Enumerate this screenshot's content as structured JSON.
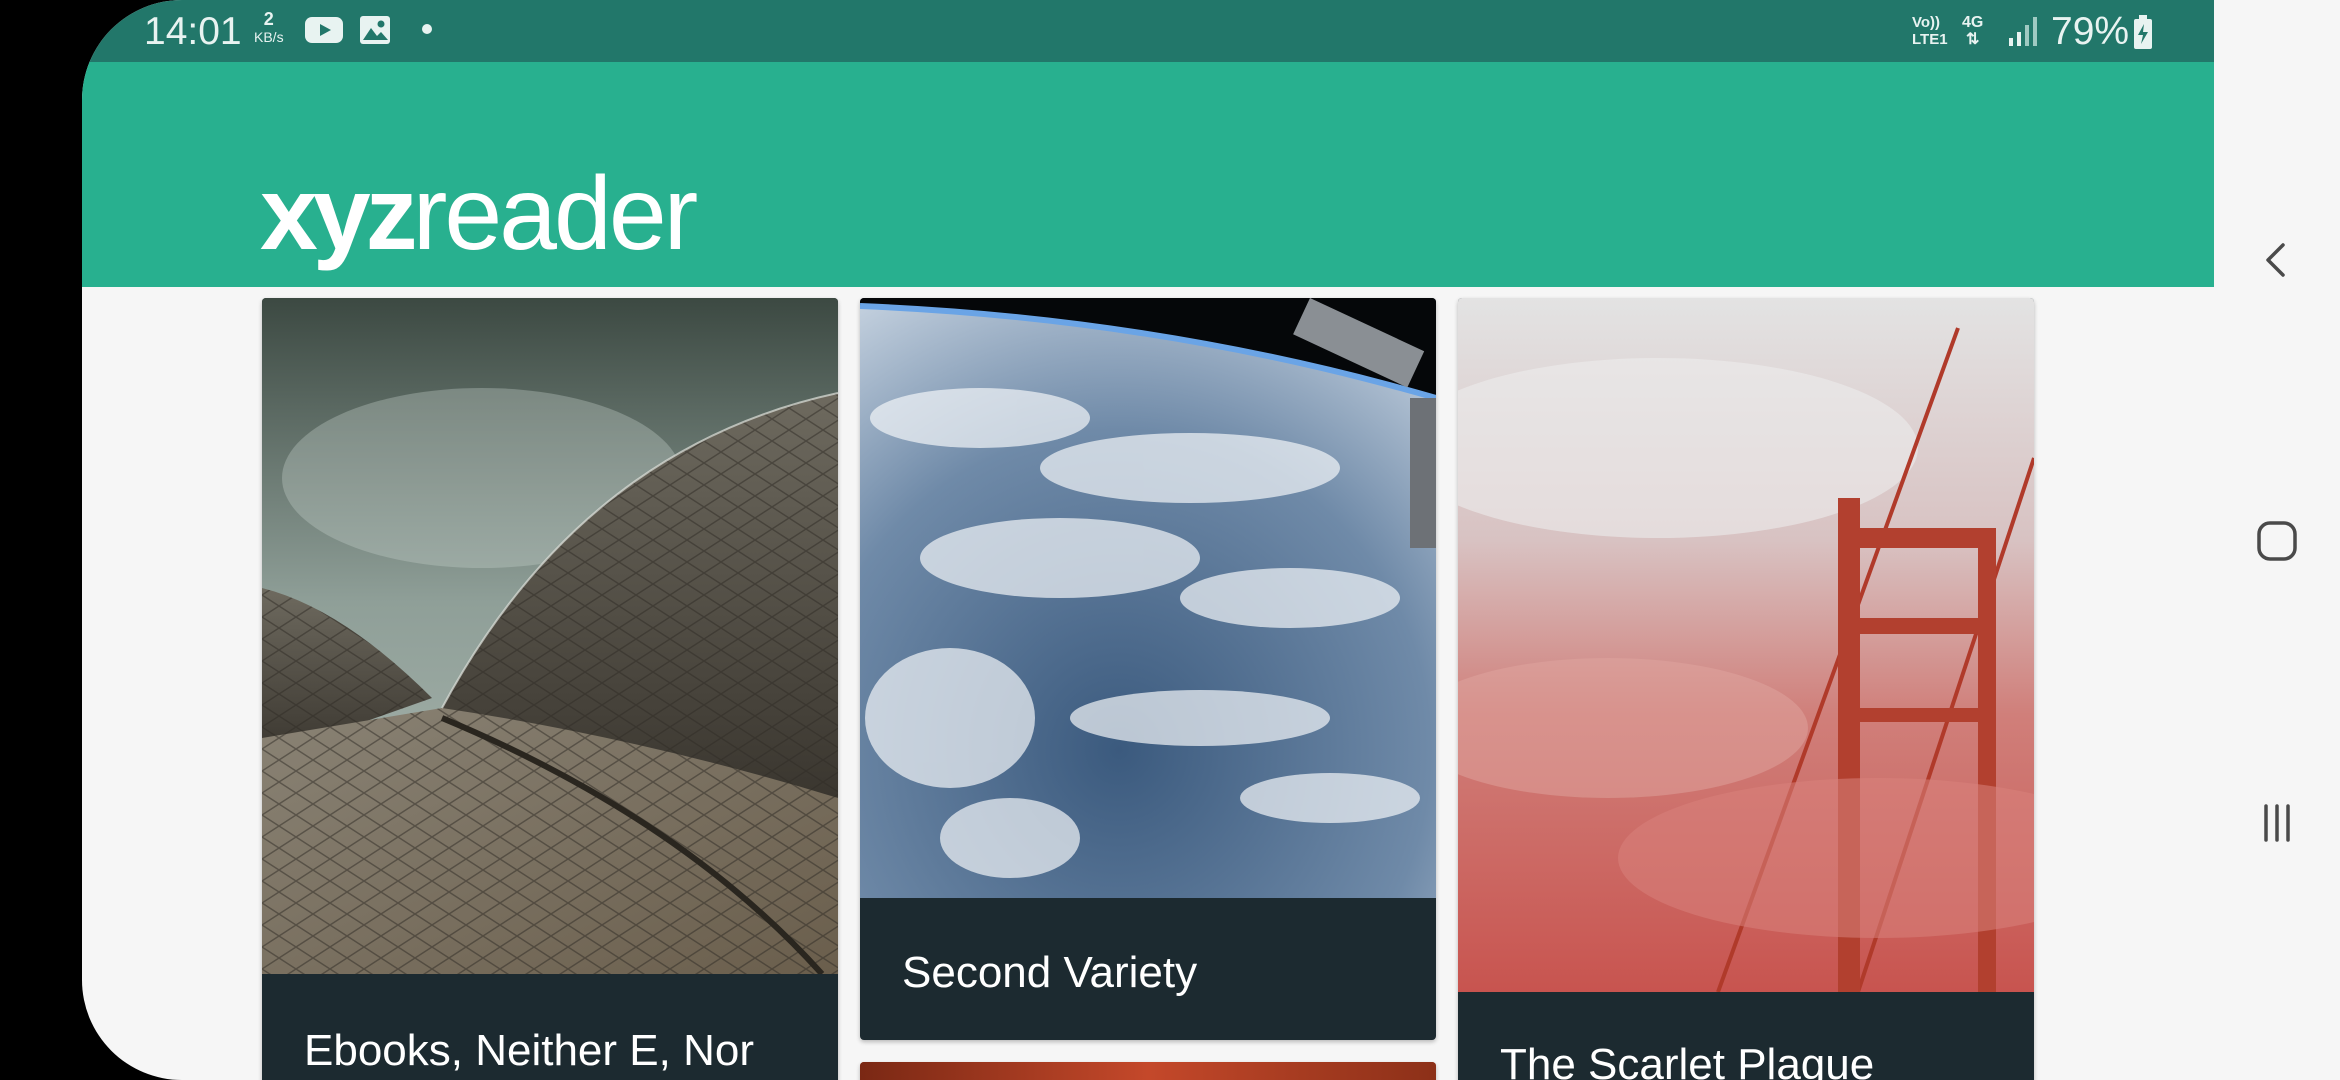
{
  "status_bar": {
    "time": "14:01",
    "net_speed_value": "2",
    "net_speed_unit": "KB/s",
    "volte_line1": "Vo))",
    "volte_line2": "LTE1",
    "network_type": "4G",
    "battery_percent": "79%",
    "notification_icons": [
      "youtube-icon",
      "gallery-icon"
    ]
  },
  "app_bar": {
    "logo_bold": "xyz",
    "logo_light": "reader",
    "color": "#28b08f"
  },
  "articles": [
    {
      "title": "Ebooks, Neither E, Nor",
      "image": "sydney-opera-house-shells"
    },
    {
      "title": "Second Variety",
      "image": "earth-from-orbit"
    },
    {
      "title": "The Scarlet Plague",
      "image": "golden-gate-bridge-in-red-fog"
    }
  ],
  "navigation_bar": {
    "buttons": [
      "back-icon",
      "home-icon",
      "recents-icon"
    ]
  },
  "colors": {
    "status_bar": "#22776a",
    "accent": "#28b08f",
    "card_footer": "#1c2a30",
    "background": "#f6f6f6"
  }
}
